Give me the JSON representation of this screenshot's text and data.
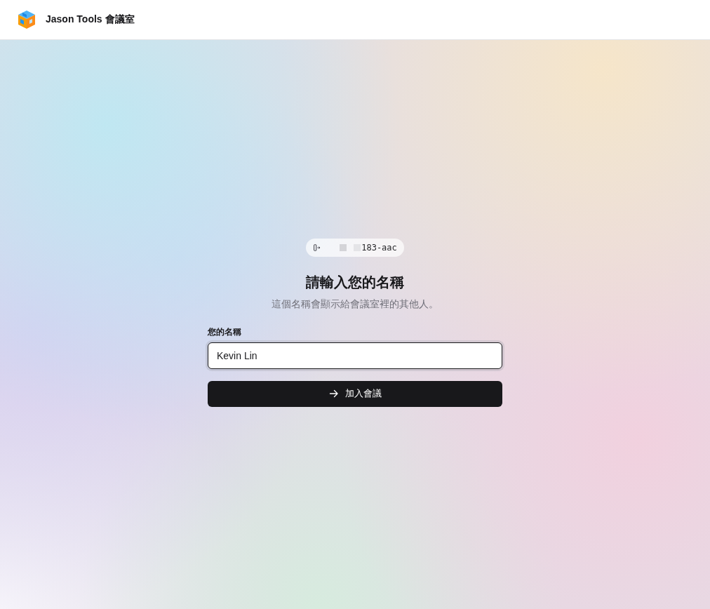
{
  "header": {
    "title": "Jason Tools 會議室"
  },
  "room_badge": {
    "code": "183-aac"
  },
  "heading": "請輸入您的名稱",
  "subtitle": "這個名稱會顯示給會議室裡的其他人。",
  "name_field": {
    "label": "您的名稱",
    "value": "Kevin Lin",
    "focused": true
  },
  "join_button": {
    "label": "加入會議"
  }
}
